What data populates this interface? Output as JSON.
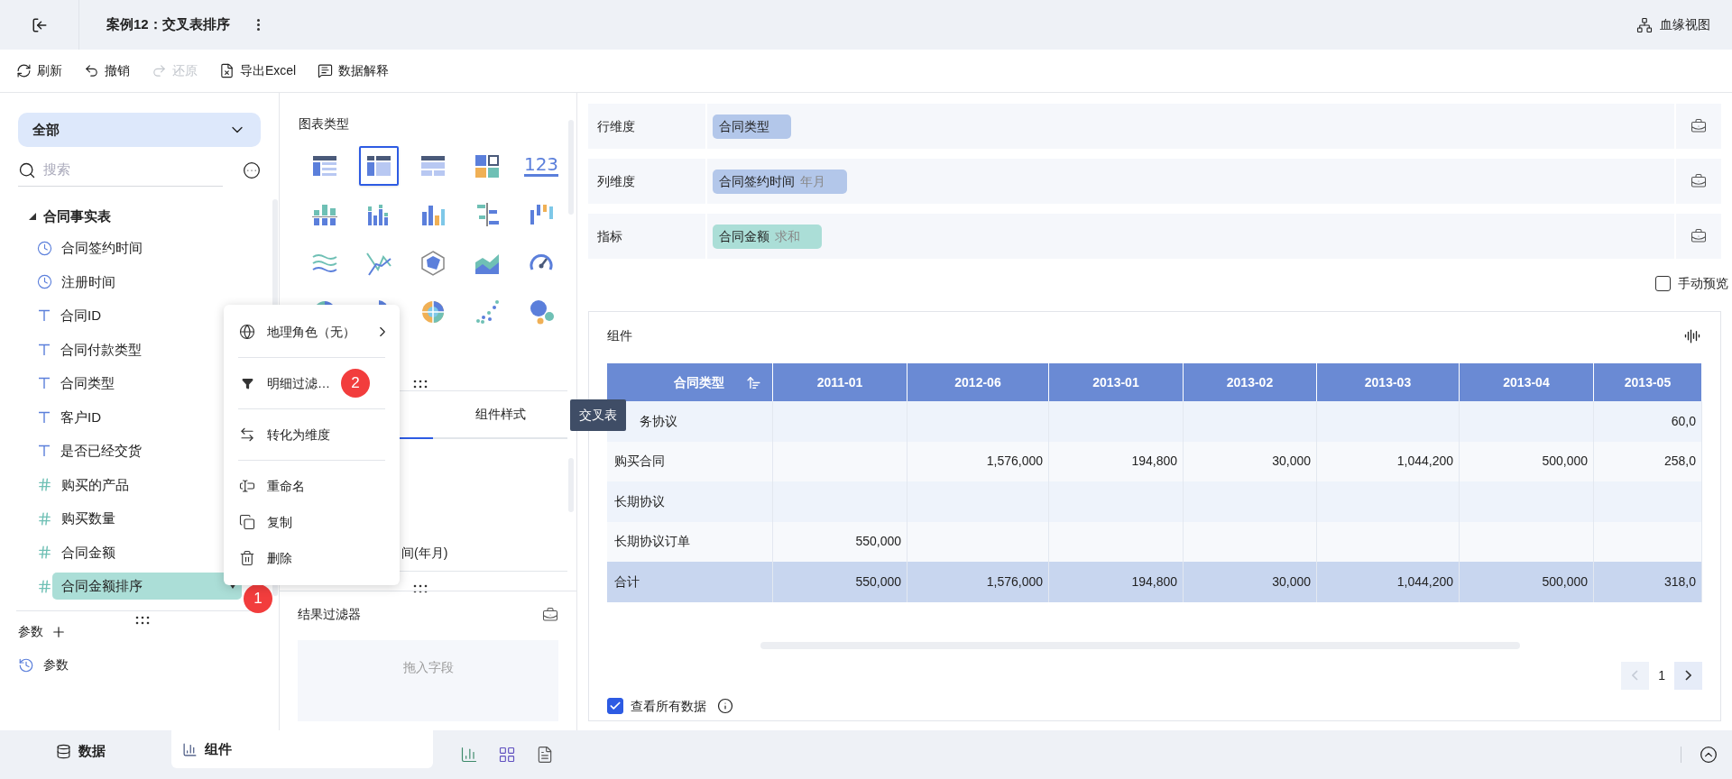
{
  "header": {
    "title": "案例12：交叉表排序",
    "lineage": "血缘视图"
  },
  "toolbar": [
    {
      "kind": "refresh",
      "label": "刷新",
      "disabled": false
    },
    {
      "kind": "undo",
      "label": "撤销",
      "disabled": false
    },
    {
      "kind": "redo",
      "label": "还原",
      "disabled": true
    },
    {
      "kind": "excel",
      "label": "导出Excel",
      "disabled": false
    },
    {
      "kind": "explain",
      "label": "数据解释",
      "disabled": false
    }
  ],
  "data_panel": {
    "dropdown": "全部",
    "search_placeholder": "搜索",
    "table_name": "合同事实表",
    "expanded": true,
    "fields": [
      {
        "kind": "time",
        "label": "合同签约时间",
        "selected": false
      },
      {
        "kind": "time",
        "label": "注册时间",
        "selected": false
      },
      {
        "kind": "text",
        "label": "合同ID",
        "selected": false
      },
      {
        "kind": "text",
        "label": "合同付款类型",
        "selected": false
      },
      {
        "kind": "text",
        "label": "合同类型",
        "selected": false
      },
      {
        "kind": "text",
        "label": "客户ID",
        "selected": false
      },
      {
        "kind": "text",
        "label": "是否已经交货",
        "selected": false
      },
      {
        "kind": "number",
        "label": "购买的产品",
        "selected": false
      },
      {
        "kind": "number",
        "label": "购买数量",
        "selected": false
      },
      {
        "kind": "number",
        "label": "合同金额",
        "selected": false
      },
      {
        "kind": "number",
        "label": "合同金额排序",
        "selected": true,
        "badge": "1"
      }
    ],
    "params_title": "参数",
    "params": [
      {
        "label": "参数"
      }
    ]
  },
  "context_menu": {
    "groups": [
      [
        {
          "kind": "geo",
          "label": "地理角色（无）",
          "submenu": true
        }
      ],
      [
        {
          "kind": "filter",
          "label": "明细过滤…",
          "badge": "2"
        }
      ],
      [
        {
          "kind": "convert",
          "label": "转化为维度"
        }
      ],
      [
        {
          "kind": "rename",
          "label": "重命名"
        },
        {
          "kind": "copy",
          "label": "复制"
        },
        {
          "kind": "delete",
          "label": "删除"
        }
      ]
    ]
  },
  "chart_types": {
    "title": "图表类型",
    "items": [
      {
        "kind": "table",
        "selected": false
      },
      {
        "kind": "cross",
        "selected": true
      },
      {
        "kind": "detail",
        "selected": false
      },
      {
        "kind": "tile",
        "selected": false
      },
      {
        "kind": "kpi",
        "label": "123",
        "selected": false
      },
      {
        "kind": "bar-stack",
        "selected": false
      },
      {
        "kind": "bar-multi",
        "selected": false
      },
      {
        "kind": "bar",
        "selected": false
      },
      {
        "kind": "bar-diverge",
        "selected": false
      },
      {
        "kind": "bar-range",
        "selected": false
      },
      {
        "kind": "wave",
        "selected": false
      },
      {
        "kind": "line",
        "selected": false
      },
      {
        "kind": "radar",
        "selected": false
      },
      {
        "kind": "area",
        "selected": false
      },
      {
        "kind": "gauge",
        "selected": false
      },
      {
        "kind": "pie"
      },
      {
        "kind": "rose"
      },
      {
        "kind": "sunburst",
        "selected": false
      },
      {
        "kind": "scatter",
        "selected": false
      },
      {
        "kind": "bubble",
        "selected": false
      }
    ]
  },
  "config_tabs": [
    {
      "label": "组件样式",
      "selected": false
    }
  ],
  "field_partial": "间(年月)",
  "result_filter": {
    "title": "结果过滤器",
    "placeholder": "拖入字段"
  },
  "shelves": [
    {
      "label": "行维度",
      "pills": [
        {
          "kind": "dimension",
          "text": "合同类型"
        }
      ]
    },
    {
      "label": "列维度",
      "pills": [
        {
          "kind": "dimension",
          "text": "合同签约时间",
          "sub": "年月"
        }
      ]
    },
    {
      "label": "指标",
      "pills": [
        {
          "kind": "measure",
          "text": "合同金额",
          "sub": "求和"
        }
      ]
    }
  ],
  "manual_preview": {
    "label": "手动预览",
    "checked": false
  },
  "widget": {
    "title": "组件",
    "table": {
      "corner": "合同类型",
      "columns": [
        "2011-01",
        "2012-06",
        "2013-01",
        "2013-02",
        "2013-03",
        "2013-04",
        "2013-05"
      ],
      "rows": [
        {
          "kind": "data",
          "label": "务协议",
          "cells": [
            null,
            null,
            null,
            null,
            null,
            null,
            "60,0"
          ]
        },
        {
          "kind": "data",
          "label": "购买合同",
          "cells": [
            null,
            "1,576,000",
            "194,800",
            "30,000",
            "1,044,200",
            "500,000",
            "258,0"
          ]
        },
        {
          "kind": "data",
          "label": "长期协议",
          "cells": [
            null,
            null,
            null,
            null,
            null,
            null,
            null
          ]
        },
        {
          "kind": "data",
          "label": "长期协议订单",
          "cells": [
            "550,000",
            null,
            null,
            null,
            null,
            null,
            null
          ]
        },
        {
          "kind": "total",
          "label": "合计",
          "cells": [
            "550,000",
            "1,576,000",
            "194,800",
            "30,000",
            "1,044,200",
            "500,000",
            "318,0"
          ]
        }
      ]
    },
    "page": "1",
    "show_all": {
      "label": "查看所有数据",
      "checked": true
    }
  },
  "tooltip": "交叉表",
  "bottom_tabs": [
    {
      "kind": "data",
      "label": "数据",
      "selected": false
    },
    {
      "kind": "widget",
      "label": "组件",
      "selected": true
    }
  ]
}
